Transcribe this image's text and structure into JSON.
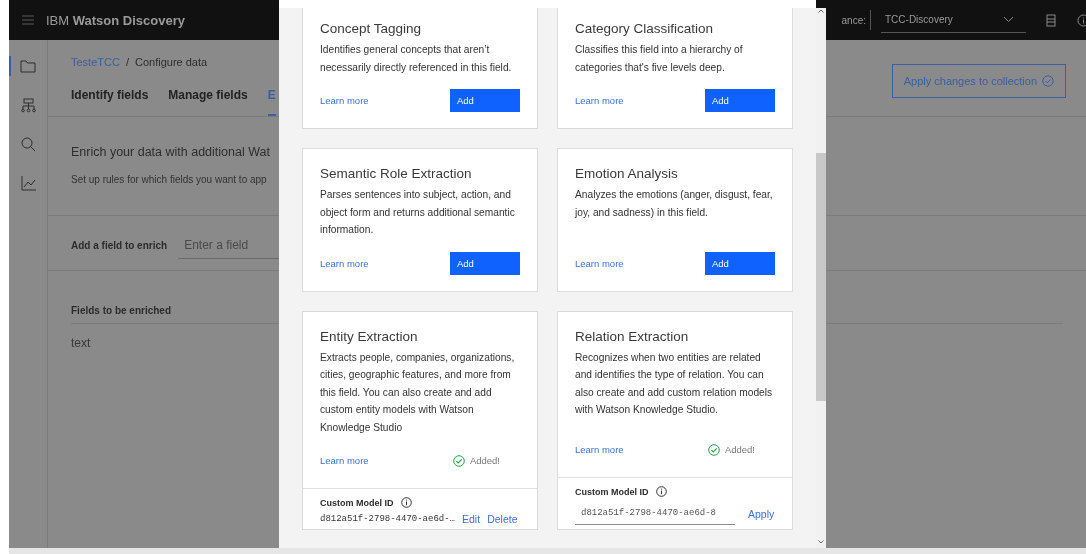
{
  "header": {
    "product": "IBM **Watson Discovery**",
    "instance_label": "ance:",
    "instance_value": "TCC-Discovery"
  },
  "breadcrumb": {
    "items": [
      "TesteTCC",
      "Configure data"
    ],
    "separator": "/"
  },
  "tabs": [
    {
      "label": "Identify fields",
      "selected": false
    },
    {
      "label": "Manage fields",
      "selected": false
    },
    {
      "label": "E",
      "selected": true
    }
  ],
  "apply_button": "Apply changes to collection",
  "enrich": {
    "title": "Enrich your data with additional Wat",
    "subtitle": "Set up rules for which fields you want to app"
  },
  "add_field": {
    "label": "Add a field to enrich",
    "placeholder": "Enter a field"
  },
  "fields_table": {
    "heading": "Fields to be enriched",
    "rows": [
      "text"
    ]
  },
  "modal": {
    "cards": [
      {
        "title": "Concept Tagging",
        "description": "Identifies general concepts that aren’t necessarily directly referenced in this field.",
        "learn_more": "Learn more",
        "status": {
          "kind": "add",
          "label": "Add"
        }
      },
      {
        "title": "Category Classification",
        "description": "Classifies this field into a hierarchy of categories that's five levels deep.",
        "learn_more": "Learn more",
        "status": {
          "kind": "add",
          "label": "Add"
        }
      },
      {
        "title": "Semantic Role Extraction",
        "description": "Parses sentences into subject, action, and object form and returns additional semantic information.",
        "learn_more": "Learn more",
        "status": {
          "kind": "add",
          "label": "Add"
        }
      },
      {
        "title": "Emotion Analysis",
        "description": "Analyzes the emotions (anger, disgust, fear, joy, and sadness) in this field.",
        "learn_more": "Learn more",
        "status": {
          "kind": "add",
          "label": "Add"
        }
      },
      {
        "title": "Entity Extraction",
        "description": "Extracts people, companies, organizations, cities, geographic features, and more from this field. You can also create and add custom entity models with Watson Knowledge Studio",
        "learn_more": "Learn more",
        "status": {
          "kind": "added",
          "label": "Added!"
        },
        "custom_model": {
          "label": "Custom Model ID",
          "kind": "static",
          "value": "d812a51f-2798-4470-ae6d-…",
          "actions": [
            "Edit",
            "Delete"
          ]
        }
      },
      {
        "title": "Relation Extraction",
        "description": "Recognizes when two entities are related and identifies the type of relation. You can also create and add custom relation models with Watson Knowledge Studio.",
        "learn_more": "Learn more",
        "status": {
          "kind": "added",
          "label": "Added!"
        },
        "custom_model": {
          "label": "Custom Model ID",
          "kind": "input",
          "value": "d812a51f-2798-4470-ae6d-8",
          "actions": [
            "Apply"
          ]
        }
      }
    ]
  }
}
